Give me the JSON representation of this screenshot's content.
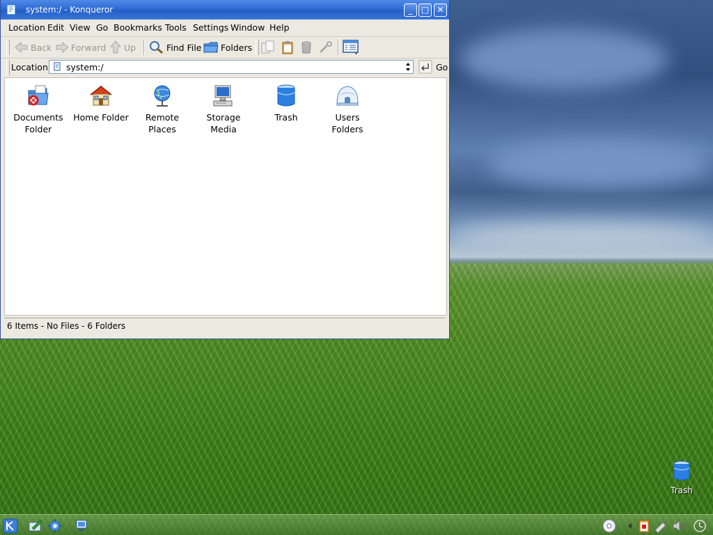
{
  "window": {
    "title": "system:/ - Konqueror",
    "controls": {
      "minimize": "_",
      "maximize": "□",
      "close": "✕"
    }
  },
  "menubar": [
    "Location",
    "Edit",
    "View",
    "Go",
    "Bookmarks",
    "Tools",
    "Settings",
    "Window",
    "Help"
  ],
  "toolbar": {
    "back": "Back",
    "forward": "Forward",
    "up": "Up",
    "find_file": "Find File",
    "folders": "Folders"
  },
  "location": {
    "label": "Location:",
    "value": "system:/",
    "go": "Go"
  },
  "items": [
    {
      "label1": "Documents",
      "label2": "Folder",
      "icon": "documents-folder-icon"
    },
    {
      "label1": "Home Folder",
      "label2": "",
      "icon": "home-folder-icon"
    },
    {
      "label1": "Remote",
      "label2": "Places",
      "icon": "remote-places-icon"
    },
    {
      "label1": "Storage",
      "label2": "Media",
      "icon": "storage-media-icon"
    },
    {
      "label1": "Trash",
      "label2": "",
      "icon": "trash-icon"
    },
    {
      "label1": "Users",
      "label2": "Folders",
      "icon": "users-folders-icon"
    }
  ],
  "status": "6 Items - No Files - 6 Folders",
  "desktop": {
    "trash_label": "Trash"
  },
  "colors": {
    "titlebar": "#2f6bd6",
    "window_bg": "#ece9e1",
    "accent": "#245fc8"
  }
}
